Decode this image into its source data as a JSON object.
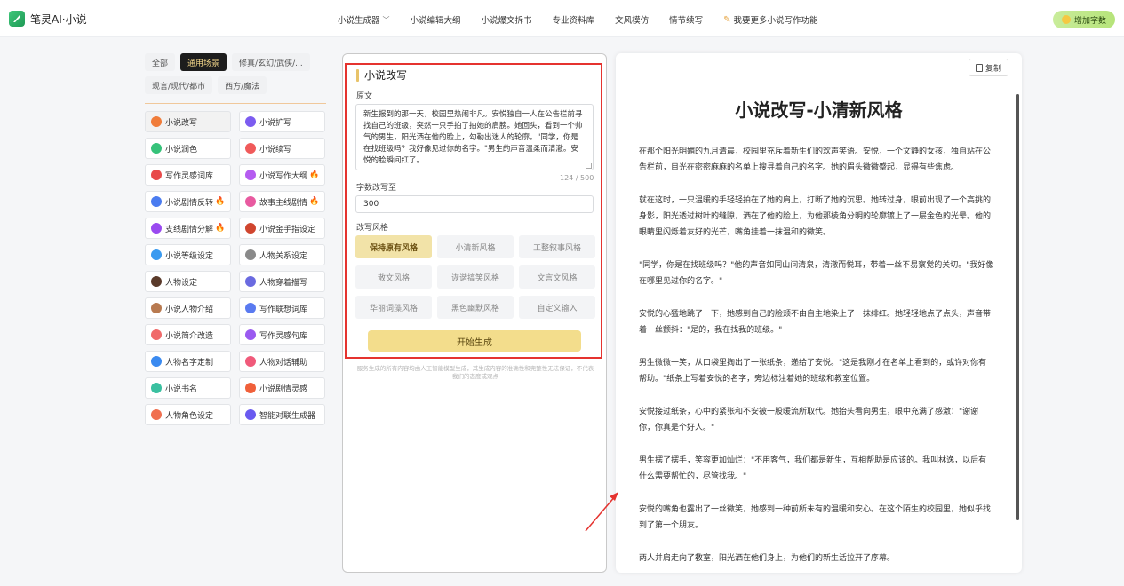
{
  "header": {
    "logo_text": "笔灵AI·小说",
    "nav": [
      {
        "label": "小说生成器",
        "has_dropdown": true
      },
      {
        "label": "小说编辑大纲"
      },
      {
        "label": "小说爆文拆书"
      },
      {
        "label": "专业资料库"
      },
      {
        "label": "文风模仿"
      },
      {
        "label": "情节续写"
      },
      {
        "label": "我要更多小说写作功能"
      }
    ],
    "add_words": "增加字数"
  },
  "filters": [
    "全部",
    "通用场景",
    "修真/玄幻/武侠/...",
    "现言/现代/都市",
    "西方/魔法"
  ],
  "active_filter": "通用场景",
  "tools": [
    {
      "label": "小说改写",
      "color": "#f07c3a",
      "active": true
    },
    {
      "label": "小说扩写",
      "color": "#7c5cf0"
    },
    {
      "label": "小说润色",
      "color": "#36c27a"
    },
    {
      "label": "小说续写",
      "color": "#f05a5a"
    },
    {
      "label": "写作灵感词库",
      "color": "#e84a4a"
    },
    {
      "label": "小说写作大纲",
      "color": "#b55cf0",
      "hot": true
    },
    {
      "label": "小说剧情反转",
      "color": "#4a7cf0",
      "hot": true
    },
    {
      "label": "故事主线剧情",
      "color": "#e85aa0",
      "hot": true
    },
    {
      "label": "支线剧情分解",
      "color": "#9a4af0",
      "hot": true
    },
    {
      "label": "小说金手指设定",
      "color": "#d0452e"
    },
    {
      "label": "小说等级设定",
      "color": "#3a9af0"
    },
    {
      "label": "人物关系设定",
      "color": "#8a8a8a"
    },
    {
      "label": "人物设定",
      "color": "#5a3a2a"
    },
    {
      "label": "人物穿着描写",
      "color": "#6a6ae0"
    },
    {
      "label": "小说人物介绍",
      "color": "#b87a50"
    },
    {
      "label": "写作联想词库",
      "color": "#5a7af0"
    },
    {
      "label": "小说简介改造",
      "color": "#f06a6a"
    },
    {
      "label": "写作灵感句库",
      "color": "#9a5af0"
    },
    {
      "label": "人物名字定制",
      "color": "#3a8af0"
    },
    {
      "label": "人物对话辅助",
      "color": "#f05a7a"
    },
    {
      "label": "小说书名",
      "color": "#3ac0a0"
    },
    {
      "label": "小说剧情灵感",
      "color": "#f0603a"
    },
    {
      "label": "人物角色设定",
      "color": "#f07050"
    },
    {
      "label": "智能对联生成器",
      "color": "#6a5af0"
    }
  ],
  "form": {
    "title": "小说改写",
    "source_label": "原文",
    "source_text": "新生报到的那一天，校园里热闹非凡。安悦独自一人在公告栏前寻找自己的班级，突然一只手拍了拍她的肩膀。她回头，看到一个帅气的男生，阳光洒在他的脸上，勾勒出迷人的轮廓。\"同学，你是在找班级吗？我好像见过你的名字。\"男生的声音温柔而清澈。安悦的脸瞬间红了。",
    "counter": "124 / 500",
    "length_label": "字数改写至",
    "length_value": "300",
    "style_label": "改写风格",
    "styles": [
      "保持原有风格",
      "小清新风格",
      "工整叙事风格",
      "散文风格",
      "诙谐搞笑风格",
      "文言文风格",
      "华丽词藻风格",
      "黑色幽默风格",
      "自定义输入"
    ],
    "active_style": "保持原有风格",
    "submit": "开始生成",
    "disclaimer": "服务生成的所有内容均由人工智能模型生成，其生成内容的准确性和完整性无法保证，不代表我们的态度或观点"
  },
  "output": {
    "copy": "复制",
    "title": "小说改写-小清新风格",
    "paragraphs": [
      "在那个阳光明媚的九月清晨，校园里充斥着新生们的欢声笑语。安悦，一个文静的女孩，独自站在公告栏前，目光在密密麻麻的名单上搜寻着自己的名字。她的眉头微微蹙起，显得有些焦虑。",
      "就在这时，一只温暖的手轻轻拍在了她的肩上，打断了她的沉思。她转过身，眼前出现了一个高挑的身影，阳光透过树叶的缝隙，洒在了他的脸上，为他那棱角分明的轮廓镀上了一层金色的光晕。他的眼睛里闪烁着友好的光芒，嘴角挂着一抹温和的微笑。",
      "\"同学，你是在找班级吗？\"他的声音如同山间清泉，清澈而悦耳，带着一丝不易察觉的关切。\"我好像在哪里见过你的名字。\"",
      "安悦的心猛地跳了一下，她感到自己的脸颊不由自主地染上了一抹绯红。她轻轻地点了点头，声音带着一丝颤抖：\"是的，我在找我的班级。\"",
      "男生微微一笑，从口袋里掏出了一张纸条，递给了安悦。\"这是我刚才在名单上看到的，或许对你有帮助。\"纸条上写着安悦的名字，旁边标注着她的班级和教室位置。",
      "安悦接过纸条，心中的紧张和不安被一股暖流所取代。她抬头看向男生，眼中充满了感激：\"谢谢你，你真是个好人。\"",
      "男生摆了摆手，笑容更加灿烂：\"不用客气，我们都是新生，互相帮助是应该的。我叫林逸，以后有什么需要帮忙的，尽管找我。\"",
      "安悦的嘴角也露出了一丝微笑，她感到一种前所未有的温暖和安心。在这个陌生的校园里，她似乎找到了第一个朋友。",
      "两人并肩走向了教室，阳光洒在他们身上，为他们的新生活拉开了序幕。"
    ]
  },
  "colors": {
    "accent": "#f3dd8c",
    "highlight_red": "#e5332f",
    "active_chip": "#1d1d1d"
  }
}
